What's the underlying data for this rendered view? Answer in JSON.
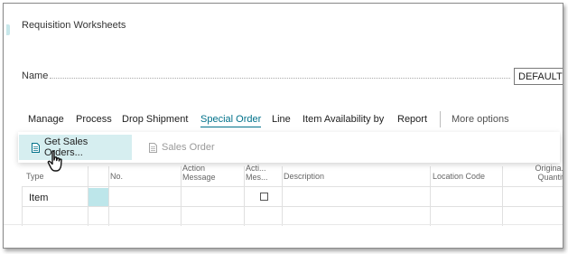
{
  "page": {
    "title": "Requisition Worksheets"
  },
  "name_field": {
    "label": "Name",
    "value": "DEFAULT"
  },
  "menu": {
    "items": [
      {
        "label": "Manage"
      },
      {
        "label": "Process"
      },
      {
        "label": "Drop Shipment"
      },
      {
        "label": "Special Order",
        "active": true
      },
      {
        "label": "Line"
      },
      {
        "label": "Item Availability by"
      },
      {
        "label": "Report"
      }
    ],
    "more_label": "More options"
  },
  "actions": {
    "get_sales_orders": "Get Sales Orders...",
    "sales_order": "Sales Order"
  },
  "grid": {
    "columns": {
      "type": "Type",
      "no": "No.",
      "action_message": "Action Message",
      "accept_action_message": "Acti... Mes...",
      "description": "Description",
      "location_code": "Location Code",
      "original_quantity": "Origina... Quantity"
    },
    "rows": [
      {
        "type": "Item",
        "accept_action_message": false
      }
    ]
  },
  "colors": {
    "accent": "#00718a",
    "selected_cell": "#bde6ea",
    "primary_action_bg": "#d6eef0"
  }
}
